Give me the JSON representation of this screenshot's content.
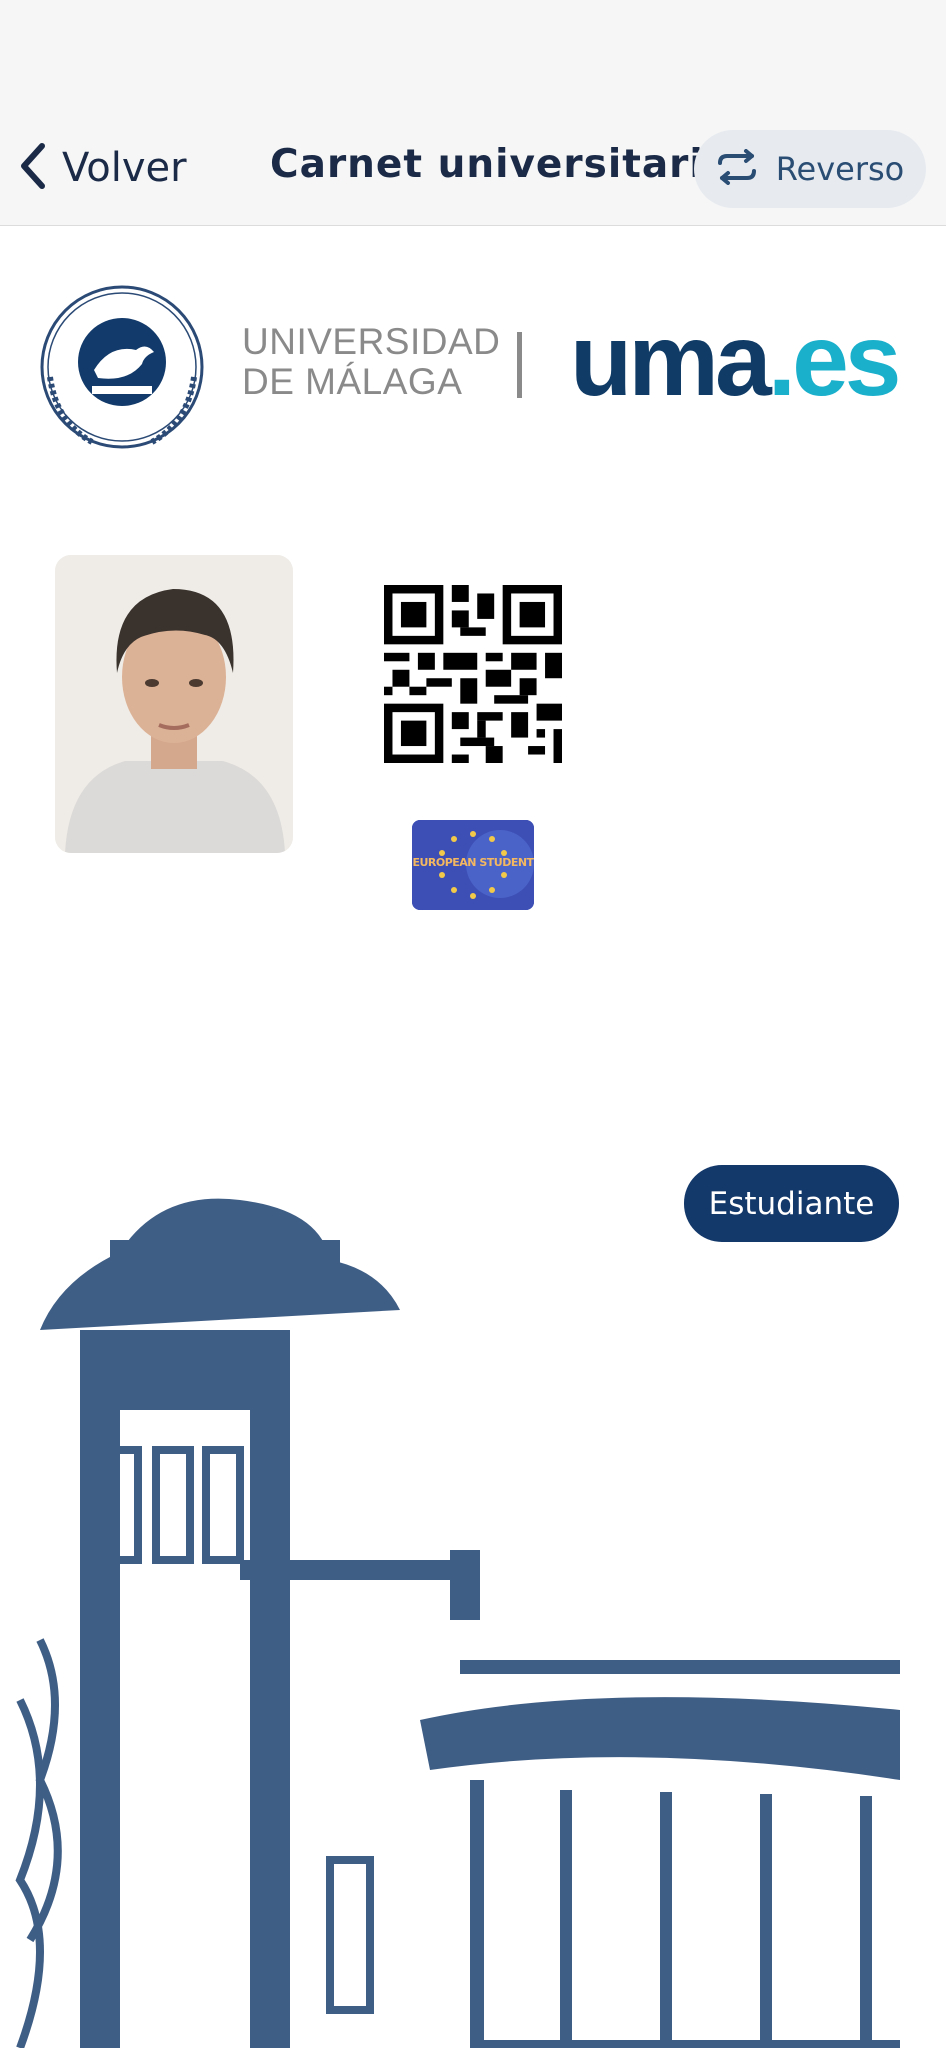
{
  "header": {
    "back_label": "Volver",
    "title": "Carnet universitario",
    "reverse_label": "Reverso"
  },
  "logo": {
    "seal_text": "UNIVERSITAS MALACITANA",
    "name_line1": "UNIVERSIDAD",
    "name_line2": "DE MÁLAGA",
    "wordmark_main": "uma",
    "wordmark_suffix": ".es"
  },
  "card": {
    "european_badge_text": "EUROPEAN STUDENT",
    "role": "Estudiante"
  },
  "colors": {
    "navy": "#1a2a47",
    "accent_blue": "#2a4d74",
    "badge_bg": "#13386a",
    "building": "#3f5e86",
    "uma_dark": "#0f3b66",
    "uma_light": "#1ab0cc"
  },
  "icons": {
    "back": "chevron-left-icon",
    "reverse": "swap-arrows-icon"
  }
}
